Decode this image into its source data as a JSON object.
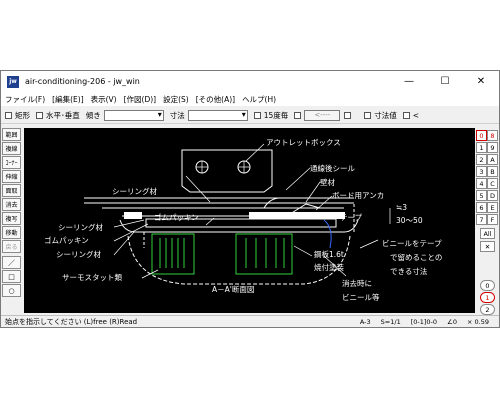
{
  "window": {
    "app_icon": "jw",
    "title": "air-conditioning-206 - jw_win",
    "controls": {
      "minimize": "—",
      "maximize": "☐",
      "close": "✕"
    }
  },
  "menu": [
    "ファイル(F)",
    "[編集(E)]",
    "表示(V)",
    "[作図(D)]",
    "設定(S)",
    "[その他(A)]",
    "ヘルプ(H)"
  ],
  "toolbar": {
    "rect": "矩形",
    "hv": "水平･垂直",
    "tilt": "傾き",
    "dim": "寸法",
    "deg15": "15度毎",
    "arrow": "<----",
    "dimval": "寸法値",
    "lt": "<"
  },
  "left_tools": [
    "範囲",
    "複線",
    "ｺｰﾅｰ",
    "伸縮",
    "面取",
    "消去",
    "複写",
    "移動",
    "戻る",
    "／",
    "□",
    "○"
  ],
  "right_layers": {
    "groups": [
      {
        "label": "0",
        "sub": "8"
      },
      {
        "label": "1",
        "sub": "9"
      },
      {
        "label": "2",
        "sub": "A"
      },
      {
        "label": "3",
        "sub": "B"
      },
      {
        "label": "4",
        "sub": "C"
      },
      {
        "label": "5",
        "sub": "D"
      },
      {
        "label": "6",
        "sub": "E"
      },
      {
        "label": "7",
        "sub": "F"
      }
    ],
    "all": "All",
    "x_icon": "✕",
    "bottom": [
      "0",
      "1",
      "2"
    ]
  },
  "drawing": {
    "labels": {
      "outlet_box": "アウトレットボックス",
      "seal": "通線後シール",
      "wall": "壁材",
      "anchor": "ボード用アンカ",
      "sealing_top": "シーリング材",
      "rubber_pack_r": "ゴムパッキン",
      "tape": "テープ",
      "approx3": "≒3",
      "range": "30～50",
      "sealing_l1": "シーリング材",
      "rubber_pack_l": "ゴムパッキン",
      "sealing_l2": "シーリング材",
      "steel_plate": "鋼板1.6t",
      "paint": "焼付塗装",
      "vinyl_note1": "ビニールをテープ",
      "vinyl_note2": "で留めることの",
      "vinyl_note3": "できる寸法",
      "thermostat": "サーモスタット類",
      "section": "A－A'断面図",
      "remove1": "消去時に",
      "remove2": "ビニール等"
    }
  },
  "status": {
    "message": "始点を指示してください (L)free (R)Read",
    "paper": "A-3",
    "scale": "S=1/1",
    "layer": "[0-1]0-0",
    "angle": "∠0",
    "zoom": "× 0.59"
  }
}
